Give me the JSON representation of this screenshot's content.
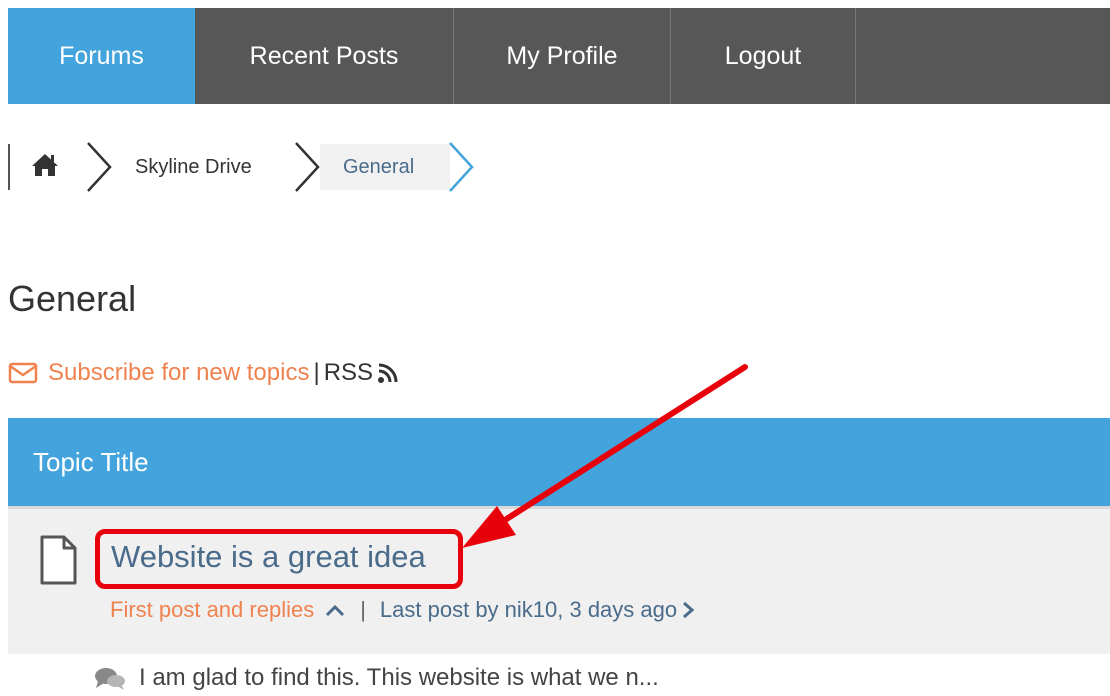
{
  "nav": {
    "items": [
      {
        "label": "Forums",
        "active": true
      },
      {
        "label": "Recent Posts",
        "active": false
      },
      {
        "label": "My Profile",
        "active": false
      },
      {
        "label": "Logout",
        "active": false
      }
    ]
  },
  "breadcrumb": {
    "home_icon": "home-icon",
    "items": [
      {
        "label": "Skyline Drive"
      },
      {
        "label": "General"
      }
    ]
  },
  "page": {
    "title": "General"
  },
  "subscribe": {
    "label": "Subscribe for new topics",
    "separator": "|",
    "rss_label": "RSS"
  },
  "topics": {
    "header": "Topic Title",
    "rows": [
      {
        "title": "Website is a great idea",
        "first_post_label": "First post and replies",
        "separator": "|",
        "last_post_label": "Last post by nik10, 3 days ago",
        "snippet": "I am glad to find this.  This website is what we n..."
      }
    ]
  },
  "colors": {
    "accent_blue": "#43a3dc",
    "nav_dark": "#575757",
    "link_orange": "#f0824f",
    "link_slate": "#4a6b8a",
    "annotation_red": "#e8000b"
  }
}
